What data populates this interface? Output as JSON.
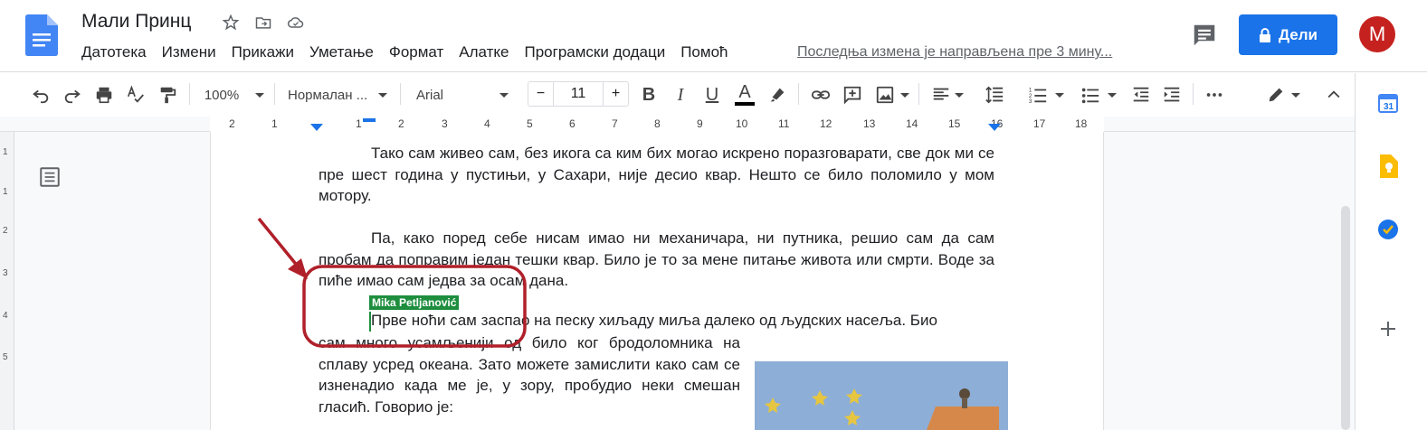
{
  "app": {
    "doc_title": "Мали Принц",
    "last_edit": "Последња измена је направљена пре 3 мину...",
    "share_label": "Дели",
    "avatar_letter": "M"
  },
  "menu": [
    "Датотека",
    "Измени",
    "Прикажи",
    "Уметање",
    "Формат",
    "Алатке",
    "Програмски додаци",
    "Помоћ"
  ],
  "toolbar": {
    "zoom": "100%",
    "style": "Нормалан ...",
    "font": "Arial",
    "font_size": "11",
    "minus": "−",
    "plus": "+"
  },
  "ruler": [
    "2",
    "1",
    "1",
    "2",
    "3",
    "4",
    "5",
    "6",
    "7",
    "8",
    "9",
    "10",
    "11",
    "12",
    "13",
    "14",
    "15",
    "16",
    "17",
    "18"
  ],
  "vruler": [
    "1",
    "1",
    "2",
    "3",
    "4",
    "5"
  ],
  "document": {
    "p1": "Тако сам живео сам, без икога са ким бих могао искрено поразговарати, све док ми се пре шест година у пустињи, у Сахари, није десио квар. Нешто се било поломило у мом мотору.",
    "p2": "Па, како поред себе нисам имао ни механичара, ни путника, решио сам да сам пробам да поправим један тешки квар. Било је то за мене питање живота или смрти. Воде за пиће имао сам једва за осам дана.",
    "p3": "Прве ноћи сам заспао на песку хиљаду миља далеко од људских насеља. Био",
    "p4": "сам много усамљенији од било ког бродоломника на сплаву усред океана. Зато можете замислити како сам се изненадио када ме је, у зору, пробудио неки смешан гласић. Говорио је:",
    "collaborator": "Mika Petljanović"
  },
  "colors": {
    "accent": "#1a73e8",
    "collaborator": "#1e8e3e",
    "annotation": "#b0202a"
  }
}
